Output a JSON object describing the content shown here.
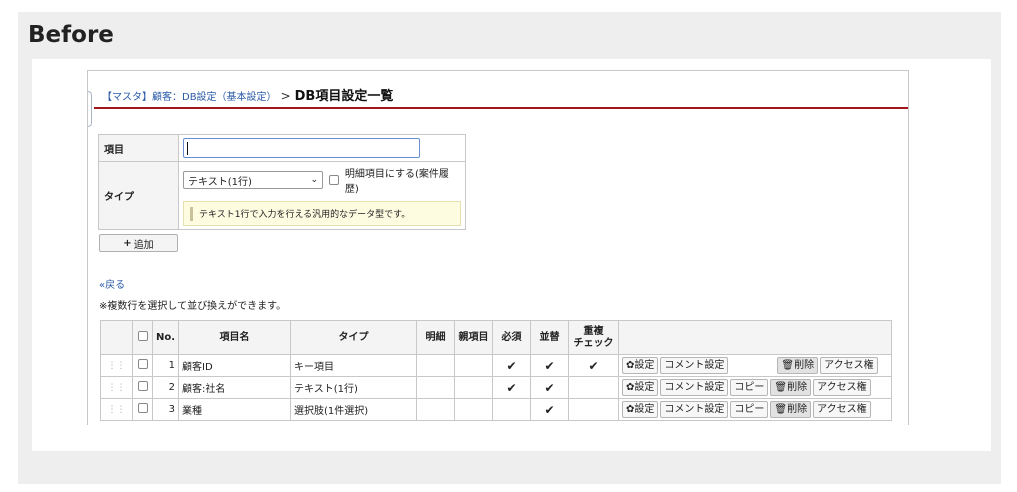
{
  "before_label": "Before",
  "breadcrumb": {
    "parent": "【マスタ】顧客：DB設定（基本設定）",
    "separator": ">",
    "current": "DB項目設定一覧"
  },
  "form": {
    "item_label": "項目",
    "item_value": "",
    "type_label": "タイプ",
    "type_selected": "テキスト(1行)",
    "detail_checkbox_label": "明細項目にする(案件履歴)",
    "detail_checked": false,
    "type_description": "テキスト1行で入力を行える汎用的なデータ型です。"
  },
  "add_button": {
    "icon": "+",
    "label": "追加"
  },
  "back_link": "«戻る",
  "sort_note": "※複数行を選択して並び換えができます。",
  "table": {
    "headers": {
      "no": "No.",
      "name": "項目名",
      "type": "タイプ",
      "detail": "明細",
      "parent": "親項目",
      "required": "必須",
      "sortable": "並替",
      "dup_line1": "重複",
      "dup_line2": "チェック"
    },
    "rows": [
      {
        "no": "1",
        "name": "顧客ID",
        "type": "キー項目",
        "required": "✔",
        "sortable": "✔",
        "dup": "✔",
        "copy": false
      },
      {
        "no": "2",
        "name": "顧客:社名",
        "type": "テキスト(1行)",
        "required": "✔",
        "sortable": "✔",
        "dup": "",
        "copy": true
      },
      {
        "no": "3",
        "name": "業種",
        "type": "選択肢(1件選択)",
        "required": "",
        "sortable": "✔",
        "dup": "",
        "copy": true
      }
    ],
    "actions": {
      "settings": "設定",
      "comment": "コメント設定",
      "copy": "コピー",
      "delete": "削除",
      "access": "アクセス権"
    }
  }
}
